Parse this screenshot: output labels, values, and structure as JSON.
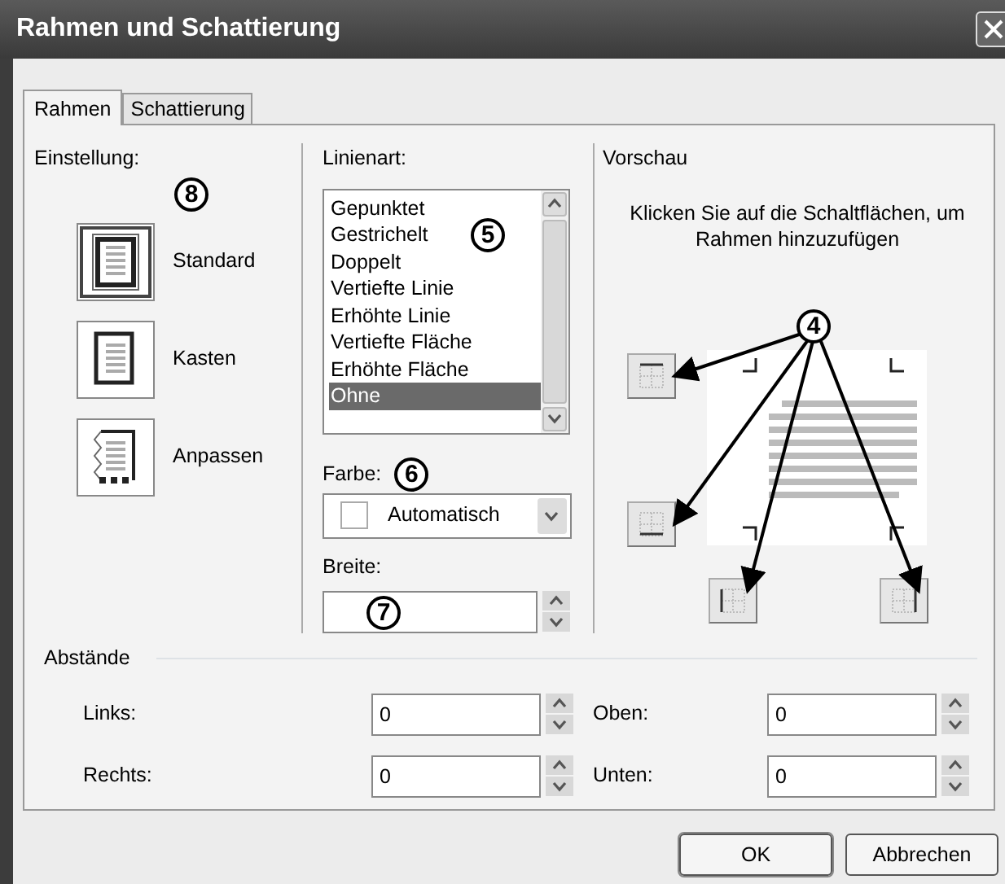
{
  "window": {
    "title": "Rahmen und Schattierung"
  },
  "tabs": [
    {
      "label": "Rahmen",
      "selected": true
    },
    {
      "label": "Schattierung",
      "selected": false
    }
  ],
  "setting": {
    "label": "Einstellung:",
    "callout": "8",
    "options": [
      {
        "kind": "standard",
        "label": "Standard",
        "selected": true
      },
      {
        "kind": "box",
        "label": "Kasten",
        "selected": false
      },
      {
        "kind": "custom",
        "label": "Anpassen",
        "selected": false
      }
    ]
  },
  "line_style": {
    "label": "Linienart:",
    "callout": "5",
    "items": [
      {
        "label": "Gepunktet",
        "selected": false
      },
      {
        "label": "Gestrichelt",
        "selected": false
      },
      {
        "label": "Doppelt",
        "selected": false
      },
      {
        "label": "Vertiefte Linie",
        "selected": false
      },
      {
        "label": "Erhöhte Linie",
        "selected": false
      },
      {
        "label": "Vertiefte Fläche",
        "selected": false
      },
      {
        "label": "Erhöhte Fläche",
        "selected": false
      },
      {
        "label": "Ohne",
        "selected": true
      }
    ]
  },
  "color": {
    "label": "Farbe:",
    "callout": "6",
    "value": "Automatisch"
  },
  "width": {
    "label": "Breite:",
    "callout": "7"
  },
  "preview": {
    "title": "Vorschau",
    "hint": "Klicken Sie auf die Schaltflächen, um Rahmen hinzuzufügen",
    "callout": "4",
    "buttons": [
      {
        "kind": "top"
      },
      {
        "kind": "bottom"
      },
      {
        "kind": "left"
      },
      {
        "kind": "right"
      }
    ]
  },
  "spacing": {
    "title": "Abstände",
    "fields": [
      {
        "label": "Links:",
        "value": "0"
      },
      {
        "label": "Oben:",
        "value": "0"
      },
      {
        "label": "Rechts:",
        "value": "0"
      },
      {
        "label": "Unten:",
        "value": "0"
      }
    ]
  },
  "buttons": [
    {
      "label": "OK",
      "kind": "default"
    },
    {
      "label": "Abbrechen",
      "kind": "normal"
    }
  ]
}
